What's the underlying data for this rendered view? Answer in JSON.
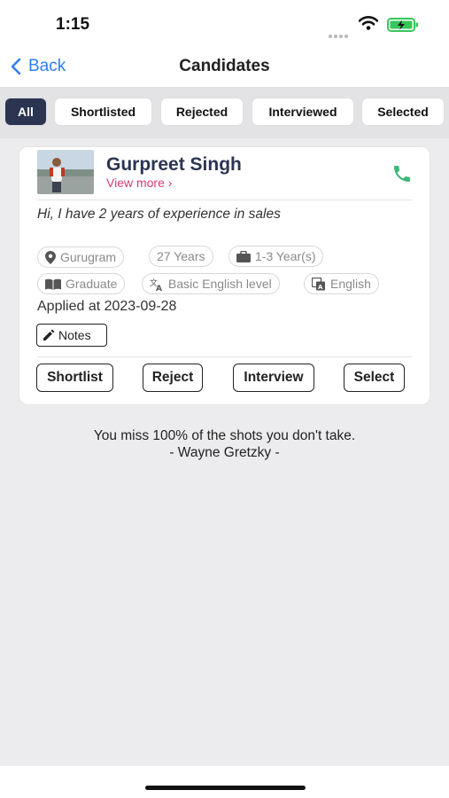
{
  "status": {
    "time": "1:15"
  },
  "nav": {
    "back_label": "Back",
    "title": "Candidates"
  },
  "filters": [
    {
      "label": "All",
      "active": true
    },
    {
      "label": "Shortlisted",
      "active": false
    },
    {
      "label": "Rejected",
      "active": false
    },
    {
      "label": "Interviewed",
      "active": false
    },
    {
      "label": "Selected",
      "active": false
    }
  ],
  "candidate": {
    "name": "Gurpreet Singh",
    "view_more": "View more ›",
    "bio": "Hi, I have 2 years of experience in sales",
    "tags": {
      "location": "Gurugram",
      "age": "27 Years",
      "experience": "1-3 Year(s)",
      "education": "Graduate",
      "english_level": "Basic English level",
      "language": "English"
    },
    "applied": "Applied at 2023-09-28",
    "notes_label": "Notes",
    "actions": [
      "Shortlist",
      "Reject",
      "Interview",
      "Select"
    ]
  },
  "quote": {
    "text": "You miss 100% of the shots you don't take.",
    "author": "- Wayne Gretzky -"
  },
  "colors": {
    "accent_blue": "#2f7cf6",
    "active_filter": "#2b3552",
    "view_more": "#d63a76",
    "phone_green": "#3cb878",
    "battery_green": "#34c759"
  },
  "icons": [
    "wifi-icon",
    "battery-icon",
    "chevron-left-icon",
    "phone-icon",
    "location-pin-icon",
    "briefcase-icon",
    "book-icon",
    "translate-icon",
    "language-icon",
    "pencil-icon"
  ]
}
